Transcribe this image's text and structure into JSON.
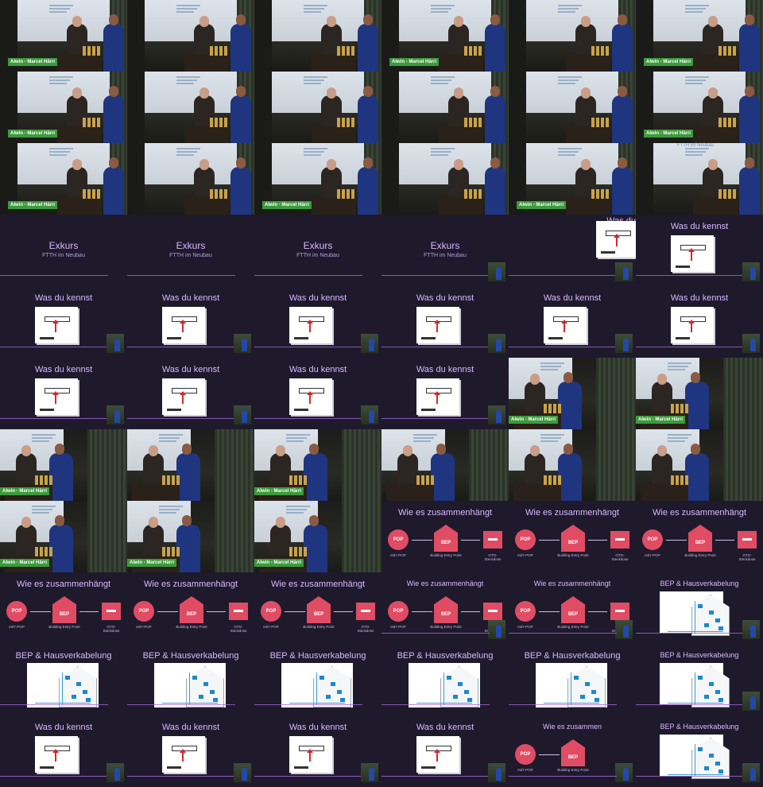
{
  "lower_third": "Alwin - Marcel Härri",
  "slides": {
    "exkurs_title": "Exkurs",
    "exkurs_subtitle": "FTTH im Neubau",
    "kennst_title": "Was du kennst",
    "zusammen_title": "Wie es zusammenhängt",
    "zusammen_title_cut": "Wie es zusammen",
    "bep_title": "BEP & Hausverkabelung",
    "wasdu_cut": "Was du",
    "pop": "POP",
    "bep": "BEP",
    "cap_pop": "Init7-POP",
    "cap_bep": "Building Entry Point",
    "cap_oto": "OTO-Steckdose",
    "ftth_caption": "FTTH im Neubau"
  },
  "grid": {
    "columns": 6,
    "rows": 11,
    "tiles": [
      "stage-lt",
      "stage",
      "stage",
      "stage-lt",
      "stage",
      "stage-lt",
      "stage-lt",
      "stage",
      "stage",
      "stage",
      "stage",
      "stage-lt",
      "stage-lt",
      "stage",
      "stage-lt",
      "stage",
      "stage-lt",
      "stage-ftth",
      "exkurs",
      "exkurs",
      "exkurs",
      "exkurs-pip",
      "wasdu",
      "kennst",
      "kennst",
      "kennst",
      "kennst",
      "kennst",
      "kennst",
      "kennst",
      "kennst",
      "kennst",
      "kennst",
      "kennst",
      "stage-wide-lt",
      "stage-wide-lt",
      "stage-wide-lt",
      "stage-wide",
      "stage-wide-lt",
      "stage-wide",
      "stage-wide",
      "stage-wide",
      "stage-wide-lt",
      "stage-wide-lt",
      "stage-wide-lt",
      "zusammen",
      "zusammen",
      "zusammen",
      "zusammen",
      "zusammen",
      "zusammen",
      "zusammen-sm",
      "zusammen-sm",
      "bep-sm",
      "bep",
      "bep",
      "bep",
      "bep",
      "bep",
      "bep-sm",
      "kennst",
      "kennst",
      "kennst",
      "kennst",
      "zusammen-cut",
      "bep-sm"
    ]
  }
}
